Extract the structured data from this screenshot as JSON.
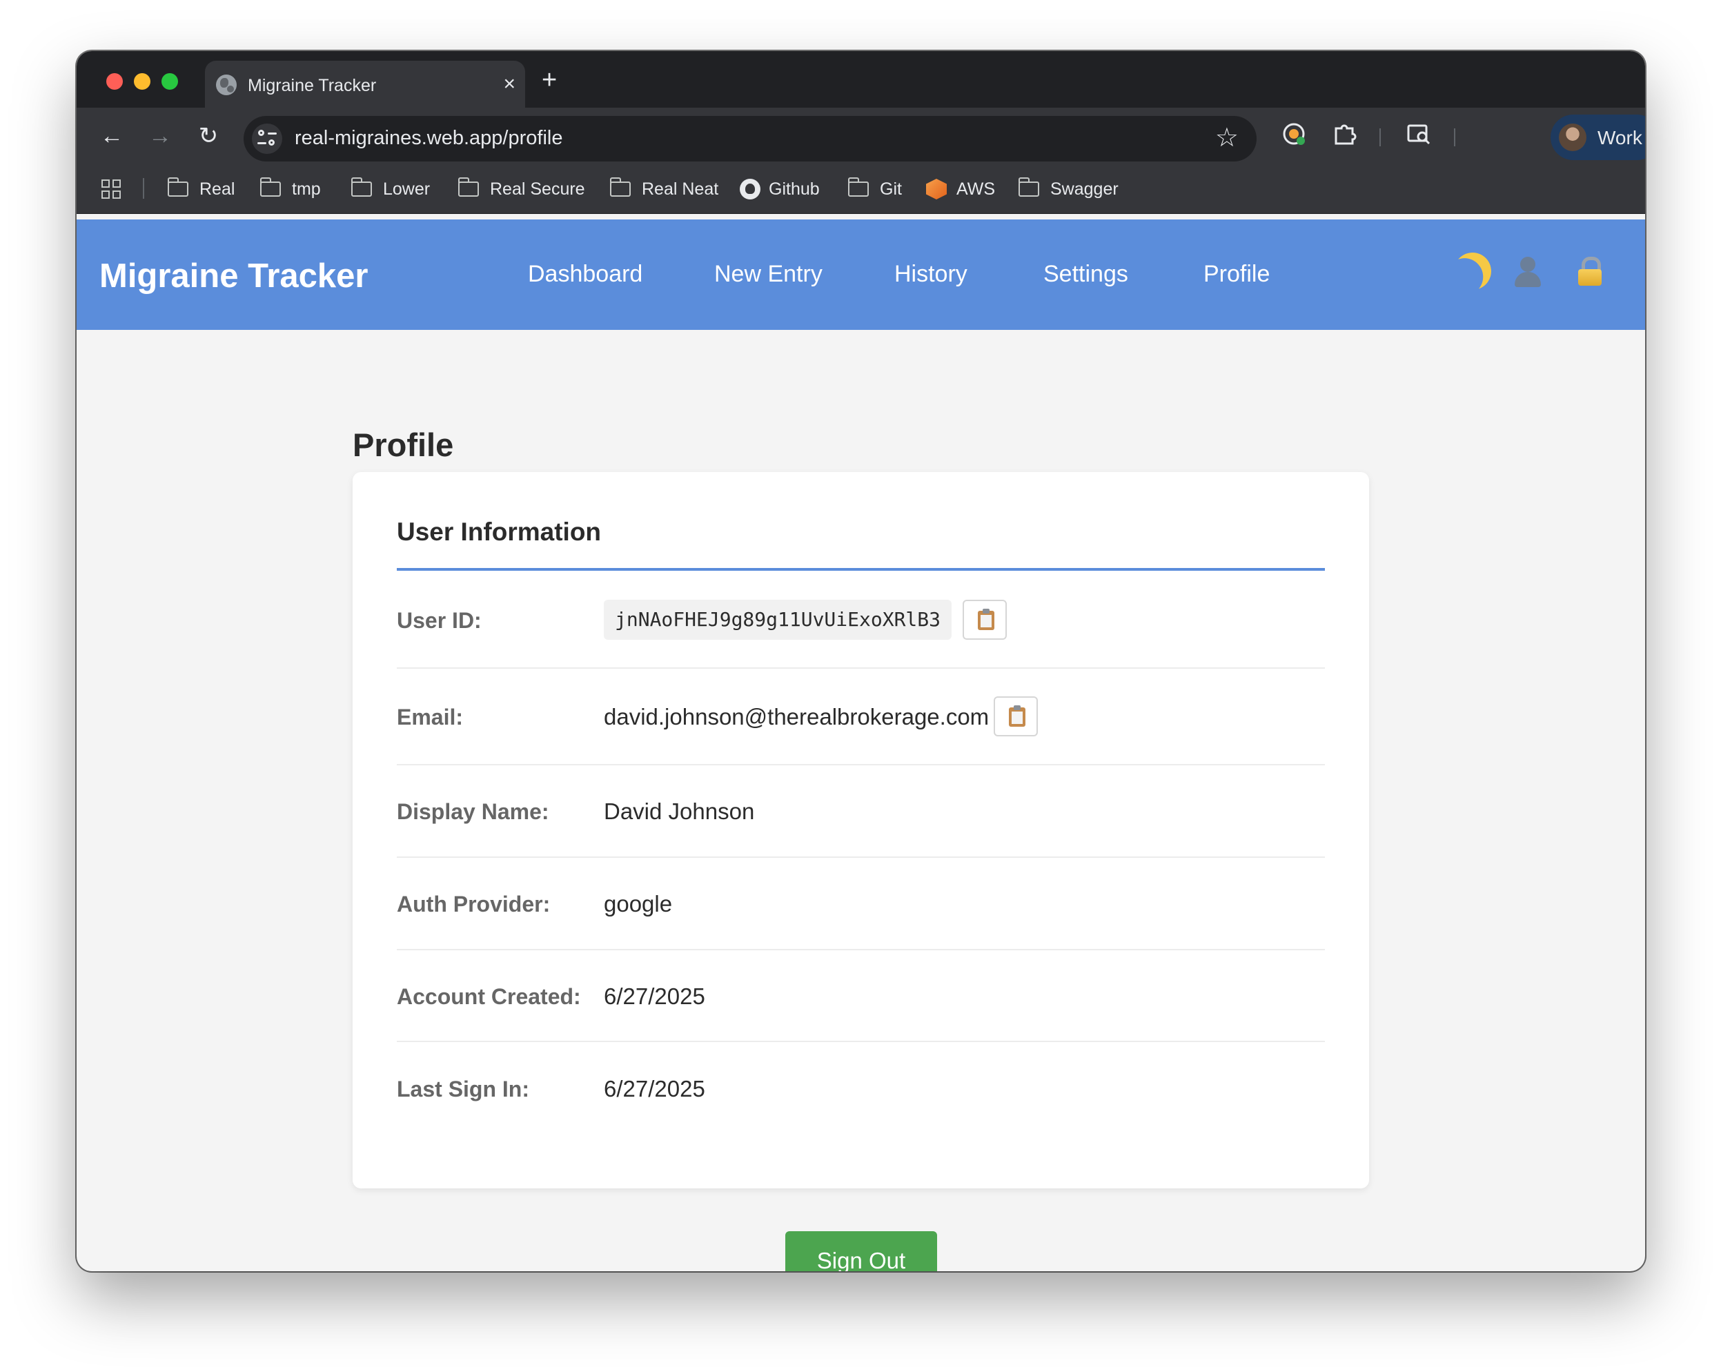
{
  "browser": {
    "tab_title": "Migraine Tracker",
    "tab_close": "×",
    "new_tab": "+",
    "url": "real-migraines.web.app/profile",
    "profile_label": "Work",
    "bookmarks": [
      "Real",
      "tmp",
      "Lower",
      "Real Secure",
      "Real Neat",
      "Github",
      "Git",
      "AWS",
      "Swagger"
    ]
  },
  "app": {
    "brand": "Migraine Tracker",
    "nav": [
      "Dashboard",
      "New Entry",
      "History",
      "Settings",
      "Profile"
    ]
  },
  "profile": {
    "page_title": "Profile",
    "section_title": "User Information",
    "user_id_label": "User ID:",
    "user_id_value": "jnNAoFHEJ9g89g11UvUiExoXRlB3",
    "email_label": "Email:",
    "email_value": "david.johnson@therealbrokerage.com",
    "display_name_label": "Display Name:",
    "display_name_value": "David Johnson",
    "auth_provider_label": "Auth Provider:",
    "auth_provider_value": "google",
    "account_created_label": "Account Created:",
    "account_created_value": "6/27/2025",
    "last_sign_in_label": "Last Sign In:",
    "last_sign_in_value": "6/27/2025",
    "sign_out_label": "Sign Out"
  },
  "colors": {
    "header_bg": "#5b8ddb",
    "sign_out_bg": "#4ca54f",
    "page_bg": "#f4f4f4"
  }
}
